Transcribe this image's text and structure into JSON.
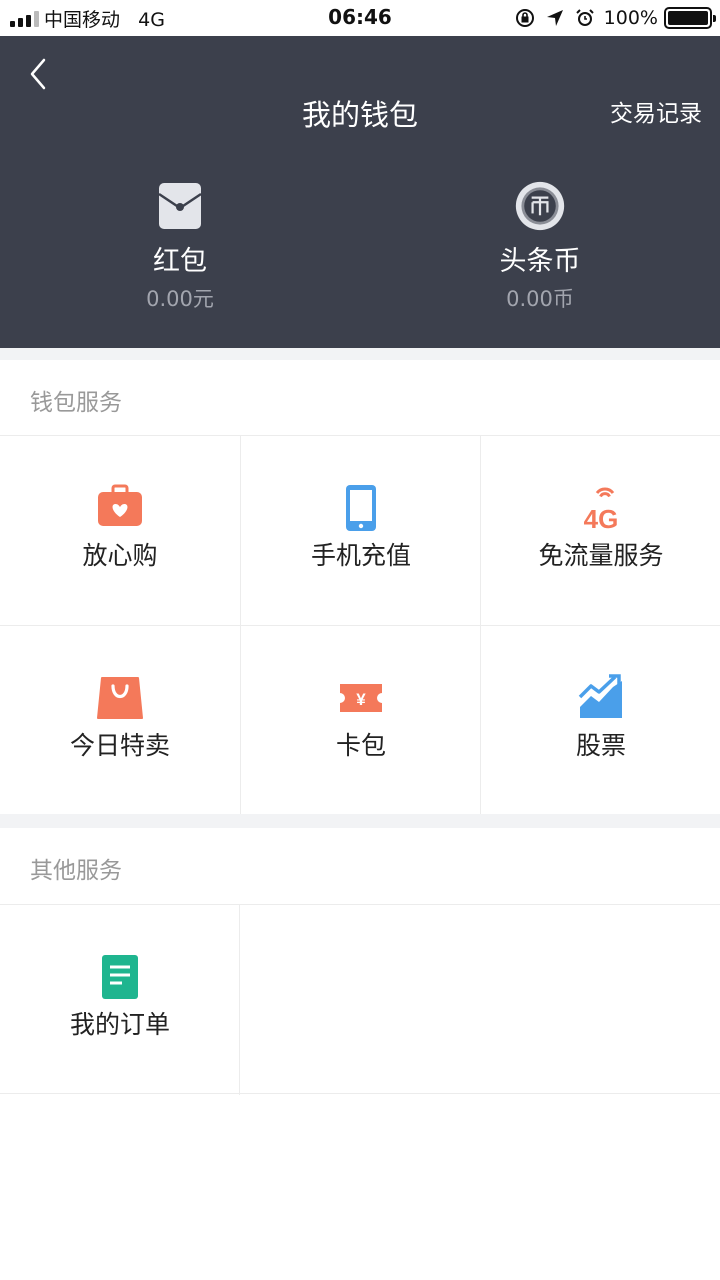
{
  "status_bar": {
    "carrier": "中国移动",
    "network": "4G",
    "time": "06:46",
    "battery": "100%"
  },
  "header": {
    "title": "我的钱包",
    "transaction_record": "交易记录",
    "bg_color": "#3c404c"
  },
  "wallet": [
    {
      "name": "红包",
      "amount": "0.00元",
      "icon": "red-envelope-icon"
    },
    {
      "name": "头条币",
      "amount": "0.00币",
      "icon": "coin-icon"
    }
  ],
  "wallet_services": {
    "title": "钱包服务",
    "items": [
      {
        "label": "放心购",
        "icon": "shopping-bag-heart-icon",
        "color": "#f4795a"
      },
      {
        "label": "手机充值",
        "icon": "phone-icon",
        "color": "#4a9fea"
      },
      {
        "label": "免流量服务",
        "icon": "4g-signal-icon",
        "color": "#f4795a",
        "icon_text": "4G"
      },
      {
        "label": "今日特卖",
        "icon": "shopping-bag-icon",
        "color": "#f4795a"
      },
      {
        "label": "卡包",
        "icon": "ticket-icon",
        "color": "#f4795a",
        "icon_text": "¥"
      },
      {
        "label": "股票",
        "icon": "stock-chart-icon",
        "color": "#4a9fea"
      }
    ]
  },
  "other_services": {
    "title": "其他服务",
    "items": [
      {
        "label": "我的订单",
        "icon": "order-document-icon",
        "color": "#1fb58f"
      }
    ]
  }
}
